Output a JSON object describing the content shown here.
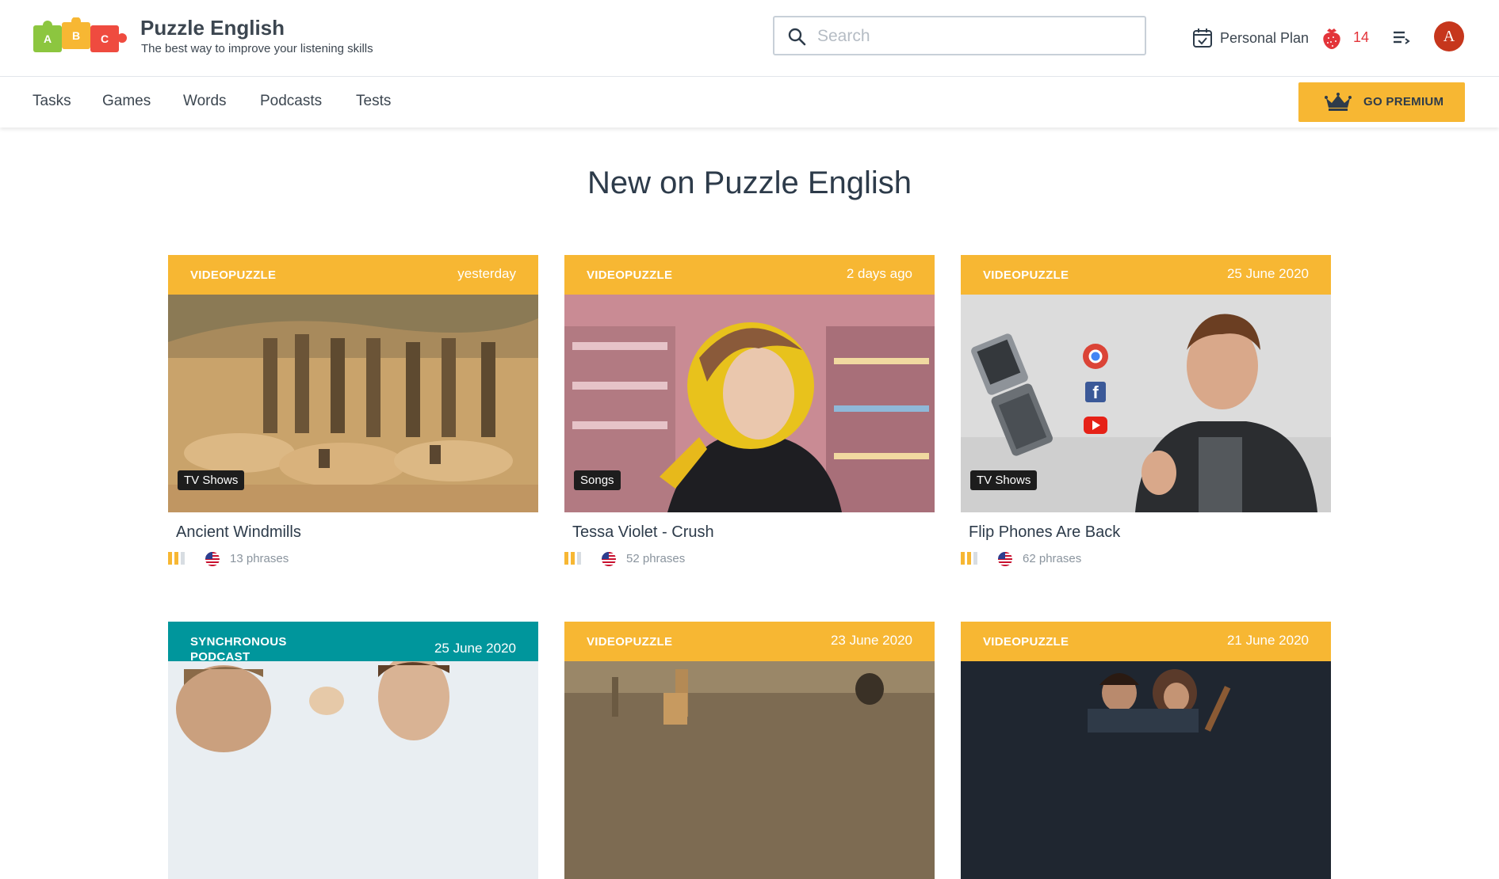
{
  "brand": {
    "title": "Puzzle English",
    "subtitle": "The best way to improve your listening skills",
    "logo_letters": [
      "A",
      "B",
      "C"
    ]
  },
  "search": {
    "placeholder": "Search",
    "value": ""
  },
  "header": {
    "personal_plan": "Personal Plan",
    "berries": "14",
    "avatar_letter": "A"
  },
  "nav": {
    "items": [
      "Tasks",
      "Games",
      "Words",
      "Podcasts",
      "Tests"
    ],
    "premium": "GO PREMIUM"
  },
  "section_title": "New on Puzzle English",
  "cards": [
    {
      "type": "VIDEOPUZZLE",
      "date": "yesterday",
      "tag": "TV Shows",
      "title": "Ancient Windmills",
      "phrases": "13 phrases"
    },
    {
      "type": "VIDEOPUZZLE",
      "date": "2 days ago",
      "tag": "Songs",
      "title": "Tessa Violet - Crush",
      "phrases": "52 phrases"
    },
    {
      "type": "VIDEOPUZZLE",
      "date": "25 June 2020",
      "tag": "TV Shows",
      "title": "Flip Phones Are Back",
      "phrases": "62 phrases"
    },
    {
      "type": "SYNCHRONOUS PODCAST",
      "date": "25 June 2020"
    },
    {
      "type": "VIDEOPUZZLE",
      "date": "23 June 2020"
    },
    {
      "type": "VIDEOPUZZLE",
      "date": "21 June 2020"
    }
  ],
  "colors": {
    "accent": "#f7b733",
    "teal": "#00969c",
    "avatar": "#c6361c",
    "berry": "#e3343a"
  }
}
